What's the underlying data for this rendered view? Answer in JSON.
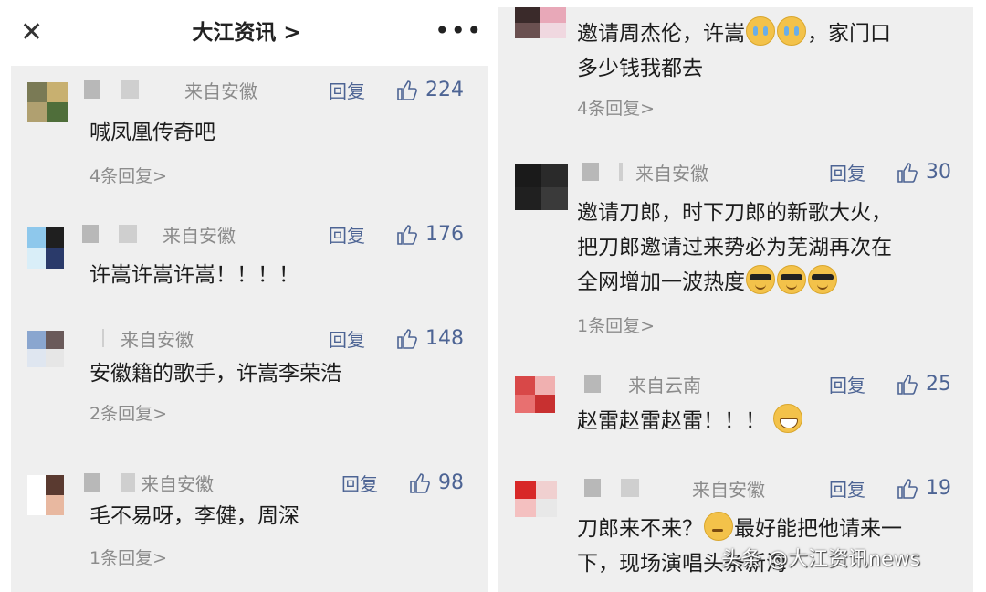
{
  "header": {
    "close_icon": "close-icon",
    "title": "大江资讯 >",
    "more_icon": "more-icon",
    "more_text": "•••"
  },
  "left_comments": [
    {
      "location": "来自安徽",
      "reply": "回复",
      "likes": "224",
      "text": "喊凤凰传奇吧",
      "sub": "4条回复>"
    },
    {
      "location": "来自安徽",
      "reply": "回复",
      "likes": "176",
      "text": "许嵩许嵩许嵩！！！！",
      "sub": ""
    },
    {
      "location": "来自安徽",
      "reply": "回复",
      "likes": "148",
      "text": "安徽籍的歌手，许嵩李荣浩",
      "sub": "2条回复>"
    },
    {
      "location": "来自安徽",
      "reply": "回复",
      "likes": "98",
      "text": "毛不易呀，李健，周深",
      "sub": "1条回复>"
    }
  ],
  "right_comments": [
    {
      "text_a": "邀请周杰伦，许嵩",
      "text_b": "，家门口",
      "text_c": "多少钱我都去",
      "sub": "4条回复>"
    },
    {
      "location": "来自安徽",
      "reply": "回复",
      "likes": "30",
      "text_a": "邀请刀郎，时下刀郎的新歌大火，",
      "text_b": "把刀郎邀请过来势必为芜湖再次在",
      "text_c": "全网增加一波热度",
      "sub": "1条回复>"
    },
    {
      "location": "来自云南",
      "reply": "回复",
      "likes": "25",
      "text_a": "赵雷赵雷赵雷！！！",
      "sub": ""
    },
    {
      "location": "来自安徽",
      "reply": "回复",
      "likes": "19",
      "text_a": "刀郎来不来？",
      "text_b": "最好能把他请来一",
      "text_c": "下，现场演唱头条新海",
      "sub": ""
    }
  ],
  "watermark": "头条 @大江资讯news",
  "colors": {
    "reply": "#4d6494",
    "meta": "#8a8a8a",
    "panel": "#efefef"
  }
}
